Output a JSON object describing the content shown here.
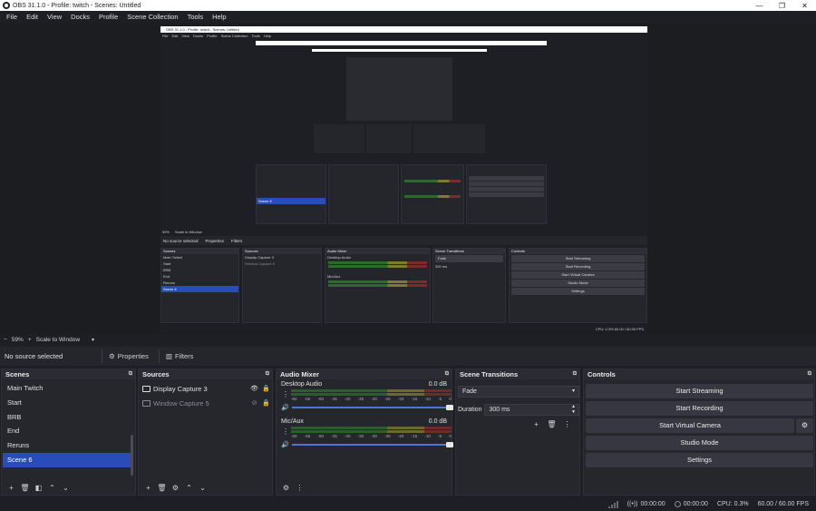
{
  "window": {
    "title": "OBS 31.1.0 - Profile: twitch - Scenes: Untitled",
    "controls": [
      "—",
      "❐",
      "✕"
    ]
  },
  "menu": [
    "File",
    "Edit",
    "View",
    "Docks",
    "Profile",
    "Scene Collection",
    "Tools",
    "Help"
  ],
  "zoom": {
    "minus": "−",
    "value": "59%",
    "plus": "+",
    "mode": "Scale to Window"
  },
  "source_bar": {
    "no_source": "No source selected",
    "properties": "Properties",
    "filters": "Filters"
  },
  "scenes": {
    "title": "Scenes",
    "items": [
      "Main Twitch",
      "Start",
      "BRB",
      "End",
      "Reruns",
      "Scene 6"
    ],
    "selected_index": 5
  },
  "sources": {
    "title": "Sources",
    "items": [
      {
        "name": "Display Capture 3",
        "visible": true
      },
      {
        "name": "Window Capture 5",
        "visible": false
      }
    ]
  },
  "mixer": {
    "title": "Audio Mixer",
    "ticks": [
      "-60",
      "-55",
      "-50",
      "-45",
      "-40",
      "-35",
      "-30",
      "-25",
      "-20",
      "-15",
      "-10",
      "-5",
      "0"
    ],
    "channels": [
      {
        "name": "Desktop Audio",
        "db": "0.0 dB",
        "volume": 1.0
      },
      {
        "name": "Mic/Aux",
        "db": "0.0 dB",
        "volume": 1.0
      }
    ]
  },
  "transitions": {
    "title": "Scene Transitions",
    "type": "Fade",
    "duration_label": "Duration",
    "duration": "300 ms"
  },
  "controls": {
    "title": "Controls",
    "start_streaming": "Start Streaming",
    "start_recording": "Start Recording",
    "start_virtual_camera": "Start Virtual Camera",
    "studio_mode": "Studio Mode",
    "settings": "Settings"
  },
  "status": {
    "stream_time": "00:00:00",
    "rec_time": "00:00:00",
    "cpu": "CPU: 0.3%",
    "fps": "60.00 / 60.00 FPS"
  },
  "colors": {
    "selected": "#284cb8",
    "background": "#1e1f24",
    "panel": "#26272d"
  },
  "preview_mini": {
    "title": "OBS 31.1.0 - Profile: twitch - Scenes: Untitled",
    "no_source": "No source selected",
    "properties": "Properties",
    "filters": "Filters",
    "zoom": "59%",
    "mode": "Scale to Window",
    "duration": "300 ms",
    "status": "CPU: 0.3%   60.00 / 60.00 FPS"
  }
}
